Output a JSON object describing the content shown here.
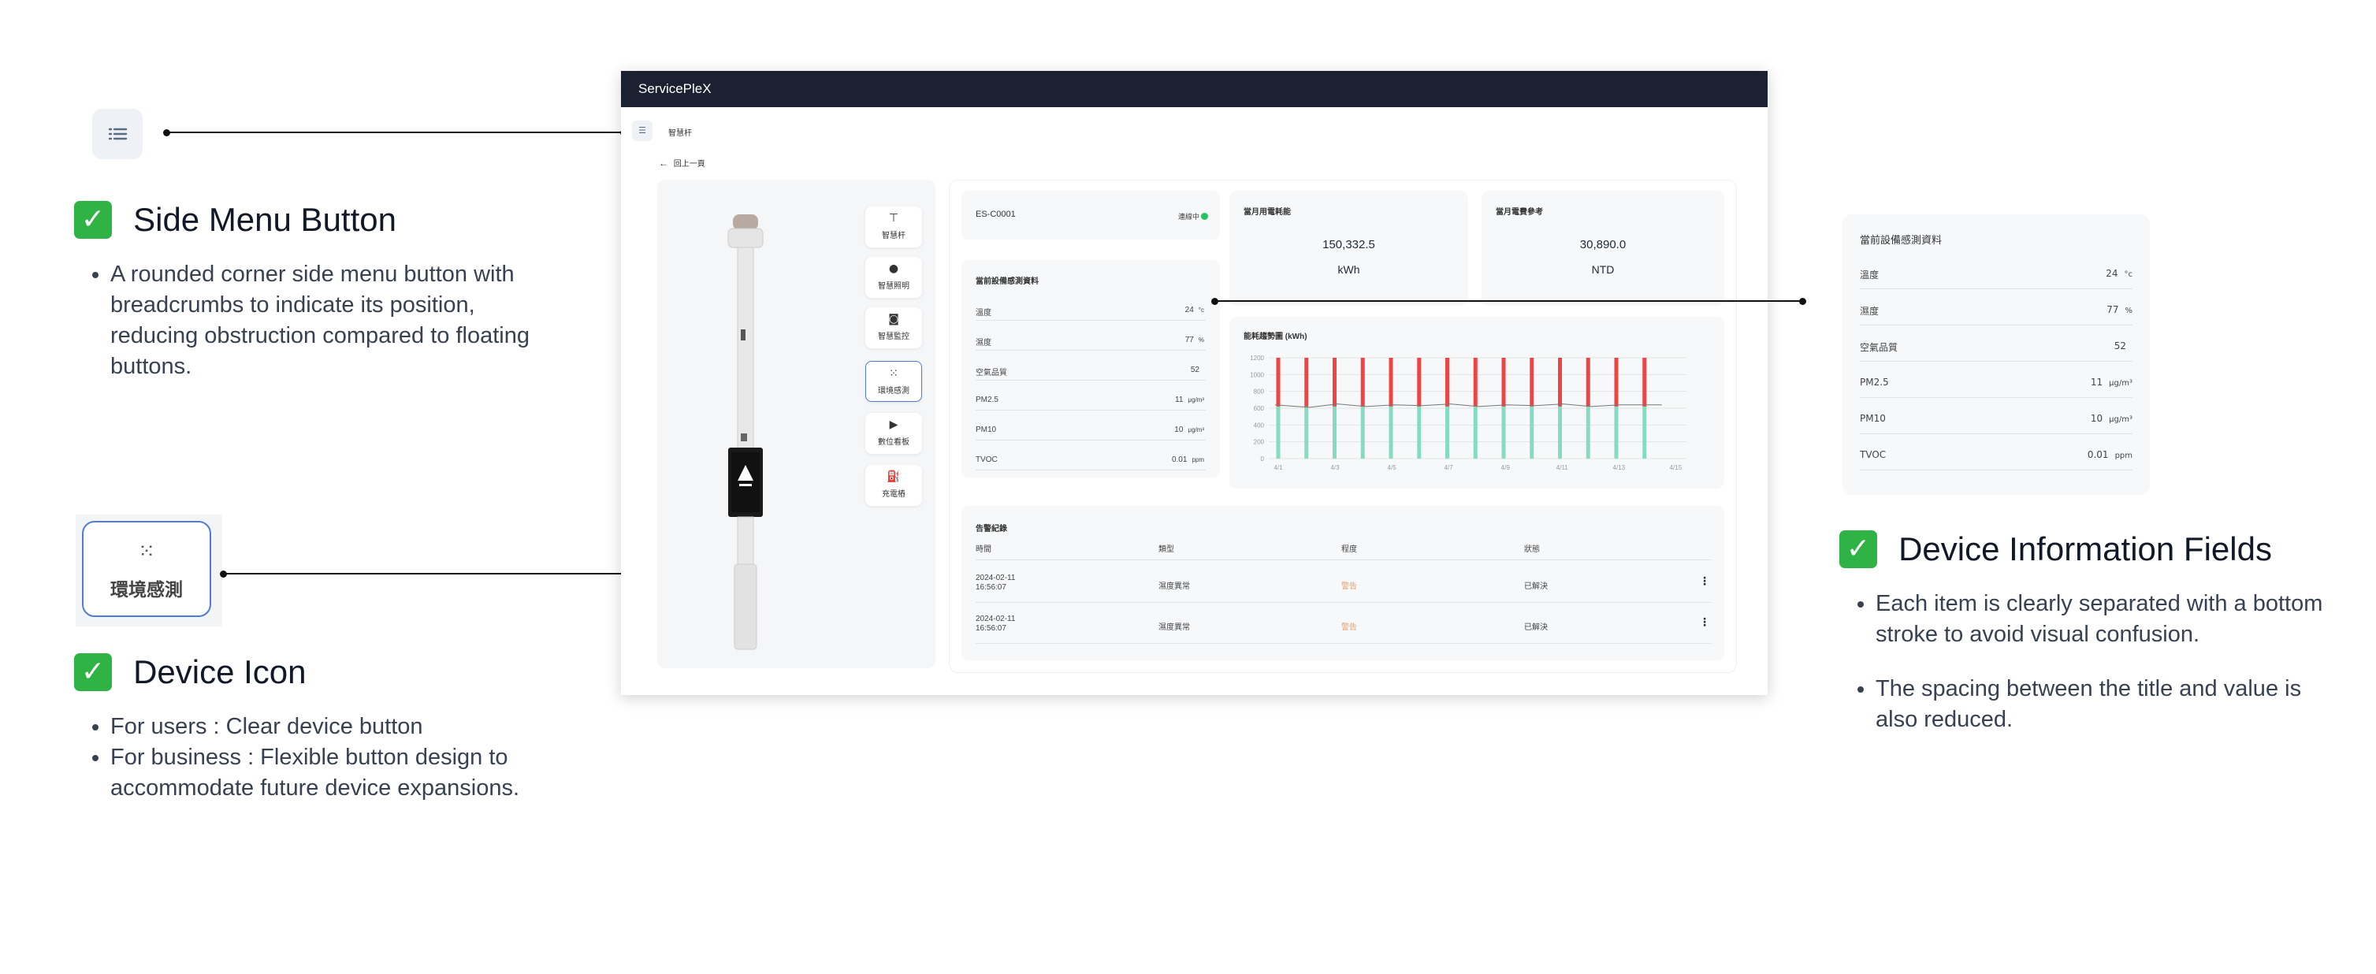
{
  "annotations": {
    "side_menu": {
      "title": "Side Menu Button",
      "bullets": [
        "A rounded corner side menu button with breadcrumbs to indicate its position, reducing obstruction compared to floating buttons."
      ]
    },
    "device_icon": {
      "title": "Device Icon",
      "bullets": [
        "For users : Clear device button",
        "For business : Flexible button design to accommodate future device expansions."
      ],
      "sample_label": "環境感測"
    },
    "device_info": {
      "title": "Device Information Fields",
      "bullets": [
        "Each item is clearly separated with a bottom stroke to avoid visual confusion.",
        "The spacing between the title and value is also reduced."
      ]
    },
    "check_mark": "✓",
    "menu_icon": "list-icon"
  },
  "app": {
    "brand": "ServicePleX",
    "breadcrumb": "智慧杆",
    "back_label": "回上一頁",
    "device_buttons": [
      {
        "icon": "street-pole-icon",
        "glyph": "⊤",
        "label": "智慧杆"
      },
      {
        "icon": "light-bulb-icon",
        "glyph": "●",
        "label": "智慧照明"
      },
      {
        "icon": "camera-icon",
        "glyph": "◙",
        "label": "智慧監控"
      },
      {
        "icon": "sensor-grid-icon",
        "glyph": "⁙",
        "label": "環境感測"
      },
      {
        "icon": "play-icon",
        "glyph": "▶",
        "label": "數位看板"
      },
      {
        "icon": "ev-charger-icon",
        "glyph": "⛽",
        "label": "充電樁"
      }
    ],
    "device": {
      "id": "ES-C0001",
      "status": "連線中",
      "status_color": "#22c55e"
    },
    "sensor_title": "當前設備感測資料",
    "sensors": [
      {
        "name": "溫度",
        "value": "24",
        "unit": "°c"
      },
      {
        "name": "濕度",
        "value": "77",
        "unit": "%"
      },
      {
        "name": "空氣品質",
        "value": "52",
        "unit": ""
      },
      {
        "name": "PM2.5",
        "value": "11",
        "unit": "μg/m³"
      },
      {
        "name": "PM10",
        "value": "10",
        "unit": "μg/m³"
      },
      {
        "name": "TVOC",
        "value": "0.01",
        "unit": "ppm"
      }
    ],
    "power": {
      "title": "當月用電耗能",
      "value": "150,332.5",
      "unit": "kWh"
    },
    "fee": {
      "title": "當月電費參考",
      "value": "30,890.0",
      "unit": "NTD"
    },
    "alerts": {
      "title": "告警紀錄",
      "headers": [
        "時間",
        "類型",
        "程度",
        "狀態"
      ],
      "rows": [
        {
          "date": "2024-02-11",
          "time": "16:56:07",
          "type": "濕度異常",
          "level": "警告",
          "status": "已解決"
        },
        {
          "date": "2024-02-11",
          "time": "16:56:07",
          "type": "濕度異常",
          "level": "警告",
          "status": "已解決"
        }
      ],
      "level_color": "#e0a06a"
    }
  },
  "zoom_panel": {
    "title": "當前設備感測資料",
    "sensors": [
      {
        "name": "溫度",
        "value": "24",
        "unit": "°c"
      },
      {
        "name": "濕度",
        "value": "77",
        "unit": "%"
      },
      {
        "name": "空氣品質",
        "value": "52",
        "unit": ""
      },
      {
        "name": "PM2.5",
        "value": "11",
        "unit": "μg/m³"
      },
      {
        "name": "PM10",
        "value": "10",
        "unit": "μg/m³"
      },
      {
        "name": "TVOC",
        "value": "0.01",
        "unit": "ppm"
      }
    ]
  },
  "chart_data": {
    "type": "bar",
    "title": "能耗趨勢圖 (kWh)",
    "ylim": [
      0,
      1200
    ],
    "yticks": [
      "1200",
      "1000",
      "800",
      "600",
      "400",
      "200",
      "0"
    ],
    "xticks": [
      "4/1",
      "4/3",
      "4/5",
      "4/7",
      "4/9",
      "4/11",
      "4/13",
      "4/15"
    ],
    "stacked": true,
    "colors": {
      "top": "#ef4444",
      "bottom": "#86dcc0",
      "line": "#777777"
    },
    "bars": [
      {
        "bottom": 620,
        "total": 1200
      },
      {
        "bottom": 620,
        "total": 1200
      },
      {
        "bottom": 620,
        "total": 1200
      },
      {
        "bottom": 620,
        "total": 1200
      },
      {
        "bottom": 620,
        "total": 1200
      },
      {
        "bottom": 620,
        "total": 1200
      },
      {
        "bottom": 620,
        "total": 1200
      },
      {
        "bottom": 620,
        "total": 1200
      },
      {
        "bottom": 620,
        "total": 1200
      },
      {
        "bottom": 620,
        "total": 1200
      },
      {
        "bottom": 620,
        "total": 1200
      },
      {
        "bottom": 620,
        "total": 1200
      },
      {
        "bottom": 620,
        "total": 1200
      },
      {
        "bottom": 620,
        "total": 1200
      }
    ],
    "line_values": [
      640,
      610,
      650,
      620,
      640,
      630,
      650,
      620,
      640,
      630,
      650,
      620,
      640,
      640
    ]
  }
}
